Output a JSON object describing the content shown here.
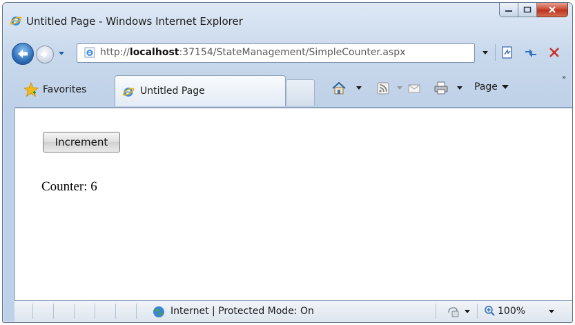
{
  "window": {
    "title": "Untitled Page - Windows Internet Explorer"
  },
  "navigation": {
    "address_prefix": "http://",
    "address_host": "localhost",
    "address_rest": ":37154/StateManagement/SimpleCounter.aspx"
  },
  "tabbar": {
    "favorites_label": "Favorites",
    "active_tab_label": "Untitled Page"
  },
  "commandbar": {
    "page_label": "Page",
    "more_label": "»"
  },
  "page": {
    "increment_button_label": "Increment",
    "counter_text": "Counter: 6"
  },
  "statusbar": {
    "zone_text": "Internet | Protected Mode: On",
    "zoom_text": "100%"
  },
  "colors": {
    "chrome_blue": "#c9d9ec",
    "close_red": "#c9432c",
    "content_bg": "#ffffff"
  }
}
